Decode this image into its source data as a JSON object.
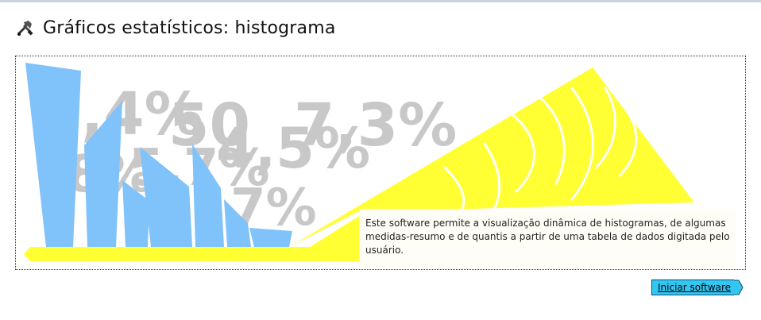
{
  "page": {
    "title": "Gráficos estatísticos: histograma",
    "icon": "tools-icon"
  },
  "banner": {
    "background_numbers": [
      ",4%",
      "50",
      "7,3%",
      "8%",
      "5,7%",
      "4,5%",
      "7%"
    ],
    "description": "Este software permite a visualização dinâmica de histogramas, de algumas medidas-resumo e de quantis a partir de uma tabela de dados digitada pelo usuário.",
    "colors": {
      "bars": "#80c2fa",
      "yellow": "#ffff33",
      "numbers": "#c8c8c8"
    }
  },
  "actions": {
    "start_label": "Iniciar software",
    "start_color": "#33c6f2"
  }
}
